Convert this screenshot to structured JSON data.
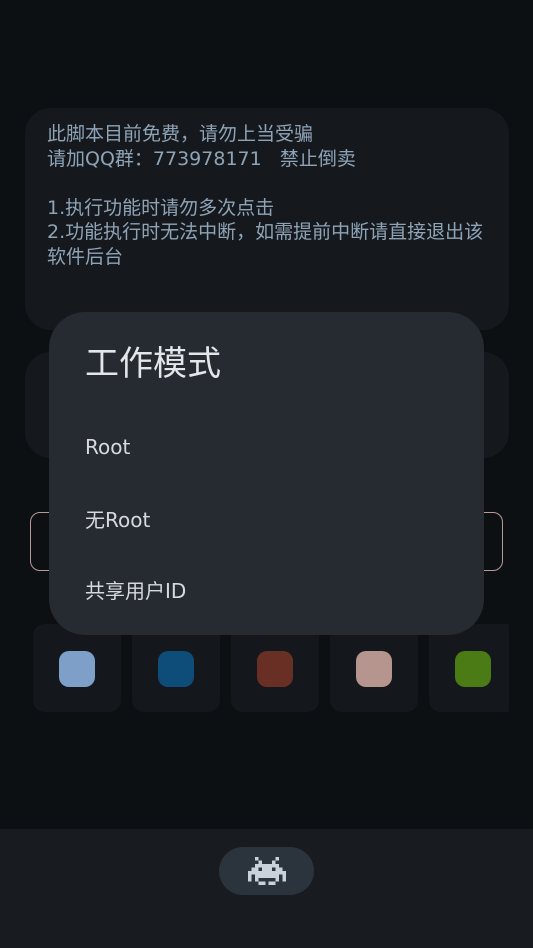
{
  "notice": {
    "text": "此脚本目前免费，请勿上当受骗\n请加QQ群：773978171   禁止倒卖\n\n1.执行功能时请勿多次点击\n2.功能执行时无法中断，如需提前中断请直接退出该软件后台"
  },
  "colors": {
    "accent_outline": "#b79a93",
    "swatches": [
      "#7d9fc8",
      "#0e4c79",
      "#6a2f24",
      "#b6958e",
      "#4a7b14"
    ]
  },
  "dialog": {
    "title": "工作模式",
    "options": [
      "Root",
      "无Root",
      "共享用户ID"
    ]
  },
  "bottom_nav": {
    "icon": "space-invader-icon"
  }
}
